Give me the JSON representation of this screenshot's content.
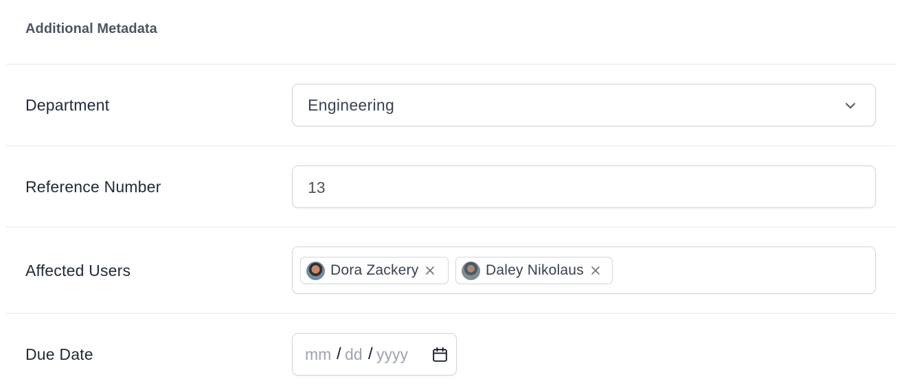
{
  "section": {
    "title": "Additional Metadata"
  },
  "fields": {
    "department": {
      "label": "Department",
      "value": "Engineering",
      "icon": "chevron-down-icon"
    },
    "reference_number": {
      "label": "Reference Number",
      "value": "13"
    },
    "affected_users": {
      "label": "Affected Users",
      "users": [
        {
          "name": "Dora Zackery",
          "avatar": "avatar-dora",
          "remove_icon": "close-icon"
        },
        {
          "name": "Daley Nikolaus",
          "avatar": "avatar-daley",
          "remove_icon": "close-icon"
        }
      ]
    },
    "due_date": {
      "label": "Due Date",
      "placeholder_month": "mm",
      "placeholder_day": "dd",
      "placeholder_year": "yyyy",
      "separator": "/",
      "icon": "calendar-icon"
    }
  },
  "colors": {
    "border": "#d1d5db",
    "divider": "#e5e7eb",
    "label": "#1f2937",
    "placeholder": "#9ca3af"
  }
}
